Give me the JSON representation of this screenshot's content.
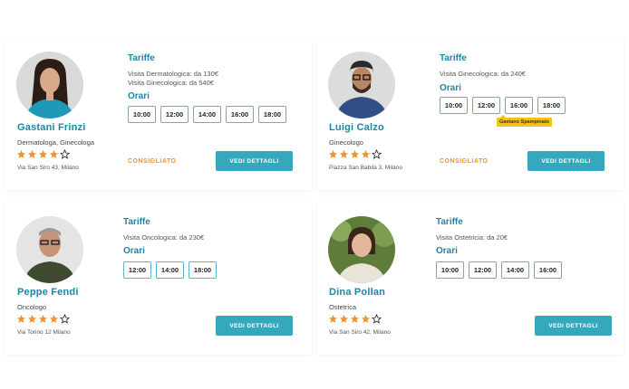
{
  "colors": {
    "accent": "#1b86a3",
    "button": "#36a8bd",
    "star": "#f0932b",
    "badge": "#f0932b",
    "tooltip": "#f4c21b"
  },
  "labels": {
    "tariffe": "Tariffe",
    "orari": "Orari",
    "consigliato": "CONSIGLIATO",
    "details_button": "VEDI DETTAGLI"
  },
  "doctors": [
    {
      "name": "Gastani Frinzi",
      "specialty": "Dermatologa, Ginecologa",
      "rating": 4,
      "rating_max": 5,
      "address": "Via San Siro 43, Milano",
      "tariffs": [
        "Visita Dermatologica: da 130€",
        "Visita Ginecologica: da 540€"
      ],
      "slots": [
        "10:00",
        "12:00",
        "14:00",
        "16:00",
        "18:00"
      ],
      "recommended": true
    },
    {
      "name": "Luigi Calzo",
      "specialty": "Ginecologo",
      "rating": 4,
      "rating_max": 5,
      "address": "Piazza San Babila 3, Milano",
      "tariffs": [
        "Visita Ginecologica: da 240€"
      ],
      "slots": [
        "10:00",
        "12:00",
        "16:00",
        "18:00"
      ],
      "tooltip": "Gaetano Spampinato",
      "recommended": true
    },
    {
      "name": "Peppe Fendi",
      "specialty": "Oncologo",
      "rating": 4,
      "rating_max": 5,
      "address": "Via Torino 12 Milano",
      "tariffs": [
        "Visita Oncologica: da 230€"
      ],
      "slots": [
        "12:00",
        "14:00",
        "18:00"
      ],
      "recommended": false
    },
    {
      "name": "Dina Pollan",
      "specialty": "Ostetrica",
      "rating": 4,
      "rating_max": 5,
      "address": "Via San Siro 42, Milano",
      "tariffs": [
        "Visita Ostetricia: da 20€"
      ],
      "slots": [
        "10:00",
        "12:00",
        "14:00",
        "16:00"
      ],
      "recommended": false
    }
  ]
}
